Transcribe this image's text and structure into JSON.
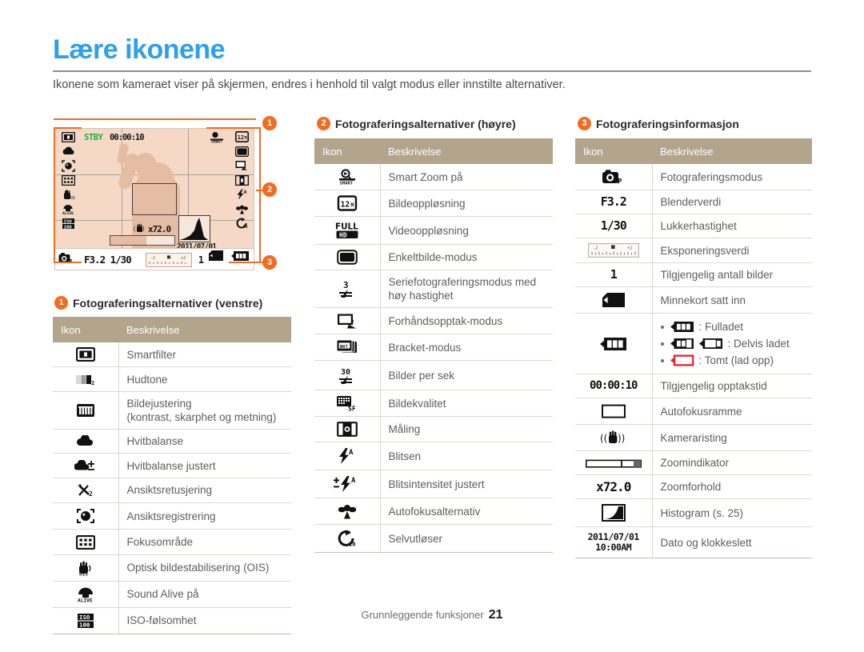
{
  "page": {
    "title": "Lære ikonene",
    "intro": "Ikonene som kameraet viser på skjermen, endres i henhold til valgt modus eller innstilte alternativer.",
    "footer_label": "Grunnleggende funksjoner",
    "footer_page": "21",
    "title_color": "#2e9ff0",
    "accent_color": "#f26c20",
    "table_header_color": "#b3a48c"
  },
  "camera_screen": {
    "stby_label": "STBY",
    "record_time": "00:00:10",
    "zoom_ratio": "x72.0",
    "date": "2011/07/01",
    "time": "10:00AM",
    "aperture_shutter": "F3.2 1/30",
    "shots_remaining": "1",
    "ev_scale": {
      "left": "-2",
      "center": "0",
      "right": "+2"
    },
    "markers": [
      "1",
      "2",
      "3"
    ],
    "left_icons": [
      "smart-filter-icon",
      "white-balance-icon",
      "face-detect-icon",
      "focus-area-icon",
      "ois-icon",
      "sound-alive-icon",
      "iso-icon"
    ],
    "right_icons": [
      "image-resolution-icon",
      "single-shot-icon",
      "pre-record-icon",
      "metering-icon",
      "flash-auto-icon",
      "macro-icon",
      "self-timer-icon"
    ],
    "right_icons_secondary": [
      "smart-zoom-icon"
    ],
    "bottom_icons": [
      "shooting-mode-icon",
      "memory-card-icon",
      "battery-icon"
    ]
  },
  "sections": [
    {
      "number": "1",
      "title": "Fotograferingsalternativer (venstre)",
      "columns": [
        "Ikon",
        "Beskrivelse"
      ],
      "rows": [
        {
          "icon": "smart-filter-icon",
          "desc": "Smartfilter"
        },
        {
          "icon": "skin-tone-icon",
          "desc": "Hudtone"
        },
        {
          "icon": "image-adjust-icon",
          "desc": "Bildejustering\n(kontrast, skarphet og metning)"
        },
        {
          "icon": "white-balance-icon",
          "desc": "Hvitbalanse"
        },
        {
          "icon": "white-balance-adj-icon",
          "desc": "Hvitbalanse justert"
        },
        {
          "icon": "face-retouch-icon",
          "desc": "Ansiktsretusjering"
        },
        {
          "icon": "face-registration-icon",
          "desc": "Ansiktsregistrering"
        },
        {
          "icon": "focus-area-icon",
          "desc": "Fokusområde"
        },
        {
          "icon": "ois-icon",
          "desc": "Optisk bildestabilisering (OIS)"
        },
        {
          "icon": "sound-alive-icon",
          "desc": "Sound Alive på"
        },
        {
          "icon": "iso-icon",
          "desc": "ISO-følsomhet"
        }
      ]
    },
    {
      "number": "2",
      "title": "Fotograferingsalternativer (høyre)",
      "columns": [
        "Ikon",
        "Beskrivelse"
      ],
      "rows": [
        {
          "icon": "smart-zoom-icon",
          "desc": "Smart Zoom på"
        },
        {
          "icon": "image-resolution-icon",
          "desc": "Bildeoppløsning"
        },
        {
          "icon": "video-resolution-icon",
          "desc": "Videooppløsning"
        },
        {
          "icon": "single-shot-icon",
          "desc": "Enkeltbilde-modus"
        },
        {
          "icon": "burst-3fps-icon",
          "desc": "Seriefotograferingsmodus med høy hastighet"
        },
        {
          "icon": "pre-record-icon",
          "desc": "Forhåndsopptak-modus"
        },
        {
          "icon": "bracket-icon",
          "desc": "Bracket-modus"
        },
        {
          "icon": "fps-30-icon",
          "desc": "Bilder per sek"
        },
        {
          "icon": "image-quality-icon",
          "desc": "Bildekvalitet"
        },
        {
          "icon": "metering-icon",
          "desc": "Måling"
        },
        {
          "icon": "flash-auto-icon",
          "desc": "Blitsen"
        },
        {
          "icon": "flash-intensity-icon",
          "desc": "Blitsintensitet justert"
        },
        {
          "icon": "macro-icon",
          "desc": "Autofokusalternativ"
        },
        {
          "icon": "self-timer-icon",
          "desc": "Selvutløser"
        }
      ]
    },
    {
      "number": "3",
      "title": "Fotograferingsinformasjon",
      "columns": [
        "Ikon",
        "Beskrivelse"
      ],
      "rows": [
        {
          "icon": "shooting-mode-icon",
          "icon_text": "",
          "desc": "Fotograferingsmodus"
        },
        {
          "icon": "aperture-text",
          "icon_text": "F3.2",
          "desc": "Blenderverdi"
        },
        {
          "icon": "shutter-text",
          "icon_text": "1/30",
          "desc": "Lukkerhastighet"
        },
        {
          "icon": "exposure-scale-icon",
          "icon_text": "",
          "desc": "Eksponeringsverdi"
        },
        {
          "icon": "shots-count-text",
          "icon_text": "1",
          "desc": "Tilgjengelig antall bilder"
        },
        {
          "icon": "memory-card-icon",
          "icon_text": "",
          "desc": "Minnekort satt inn"
        },
        {
          "icon": "battery-icon",
          "icon_text": "",
          "desc": "__BATTERY_LIST__"
        },
        {
          "icon": "rec-time-text",
          "icon_text": "00:00:10",
          "desc": "Tilgjengelig opptakstid"
        },
        {
          "icon": "af-frame-icon",
          "icon_text": "",
          "desc": "Autofokusramme"
        },
        {
          "icon": "camera-shake-icon",
          "icon_text": "",
          "desc": "Kameraristing"
        },
        {
          "icon": "zoom-indicator-icon",
          "icon_text": "",
          "desc": "Zoomindikator"
        },
        {
          "icon": "zoom-ratio-text",
          "icon_text": "x72.0",
          "desc": "Zoomforhold"
        },
        {
          "icon": "histogram-icon",
          "icon_text": "",
          "desc": "Histogram (s. 25)"
        },
        {
          "icon": "date-time-text",
          "icon_text": "2011/07/01 10:00AM",
          "desc": "Dato og klokkeslett"
        }
      ],
      "battery_states": [
        {
          "state": "full",
          "label": ": Fulladet"
        },
        {
          "state": "partial",
          "label": ": Delvis ladet"
        },
        {
          "state": "empty",
          "label": ": Tomt (lad opp)"
        }
      ]
    }
  ]
}
